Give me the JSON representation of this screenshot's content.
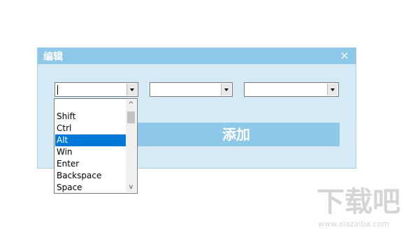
{
  "dialog": {
    "title": "编辑",
    "close_icon": "×",
    "add_button_label": "添加"
  },
  "combos": [
    {
      "value": ""
    },
    {
      "value": ""
    },
    {
      "value": ""
    }
  ],
  "dropdown": {
    "items": [
      "Shift",
      "Ctrl",
      "Alt",
      "Win",
      "Enter",
      "Backspace",
      "Space"
    ],
    "selected": "Alt"
  },
  "scrollbar": {
    "up_icon": "^",
    "down_icon": "v"
  },
  "watermark": {
    "text": "下载吧",
    "url": "www.xiazaiba.com"
  },
  "colors": {
    "titlebar": "#8ec8e8",
    "dialog_bg": "#d6eaf5",
    "selection": "#0078d7",
    "button": "#8ec8e8"
  }
}
